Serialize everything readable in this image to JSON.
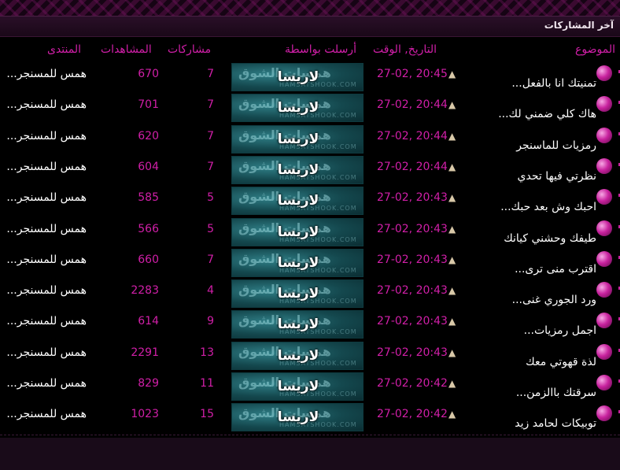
{
  "section": {
    "title": "آخر المشاركات"
  },
  "columns": {
    "topic": "الموضوع",
    "datetime": "التاريخ, الوقت",
    "author": "أرسلت بواسطة",
    "replies": "مشاركات",
    "views": "المشاهدات",
    "forum": "المنتدى"
  },
  "watermark": {
    "text": "همسات الشوق",
    "site": "HAMSATSHOOK.COM"
  },
  "colors": {
    "accent": "#d11fa8",
    "background": "#000000",
    "text": "#ffffff"
  },
  "rows": [
    {
      "topic": "تمنيتك انا بالفعل...",
      "datetime": "27-02, 20:45",
      "author": "لاريسا",
      "replies": "7",
      "views": "670",
      "forum": "همس للمسنجر..."
    },
    {
      "topic": "هاك كلي ضمني لك...",
      "datetime": "27-02, 20:44",
      "author": "لاريسا",
      "replies": "7",
      "views": "701",
      "forum": "همس للمسنجر..."
    },
    {
      "topic": "رمزيات للماسنجر",
      "datetime": "27-02, 20:44",
      "author": "لاريسا",
      "replies": "7",
      "views": "620",
      "forum": "همس للمسنجر..."
    },
    {
      "topic": "نظرتي فيها تحدي",
      "datetime": "27-02, 20:44",
      "author": "لاريسا",
      "replies": "7",
      "views": "604",
      "forum": "همس للمسنجر..."
    },
    {
      "topic": "احبك وش بعد حبك...",
      "datetime": "27-02, 20:43",
      "author": "لاريسا",
      "replies": "5",
      "views": "585",
      "forum": "همس للمسنجر..."
    },
    {
      "topic": "طيفك وحشني كيانك",
      "datetime": "27-02, 20:43",
      "author": "لاريسا",
      "replies": "5",
      "views": "566",
      "forum": "همس للمسنجر..."
    },
    {
      "topic": "اقترب منى ترى...",
      "datetime": "27-02, 20:43",
      "author": "لاريسا",
      "replies": "7",
      "views": "660",
      "forum": "همس للمسنجر..."
    },
    {
      "topic": "ورد الجوري غنى...",
      "datetime": "27-02, 20:43",
      "author": "لاريسا",
      "replies": "4",
      "views": "2283",
      "forum": "همس للمسنجر..."
    },
    {
      "topic": "اجمل رمزيات...",
      "datetime": "27-02, 20:43",
      "author": "لاريسا",
      "replies": "9",
      "views": "614",
      "forum": "همس للمسنجر..."
    },
    {
      "topic": "لذة قهوتي معك",
      "datetime": "27-02, 20:43",
      "author": "لاريسا",
      "replies": "13",
      "views": "2291",
      "forum": "همس للمسنجر..."
    },
    {
      "topic": "سرقتك باالزمن...",
      "datetime": "27-02, 20:42",
      "author": "لاريسا",
      "replies": "11",
      "views": "829",
      "forum": "همس للمسنجر..."
    },
    {
      "topic": "توبيكات لحامد زيد",
      "datetime": "27-02, 20:42",
      "author": "لاريسا",
      "replies": "15",
      "views": "1023",
      "forum": "همس للمسنجر..."
    }
  ]
}
